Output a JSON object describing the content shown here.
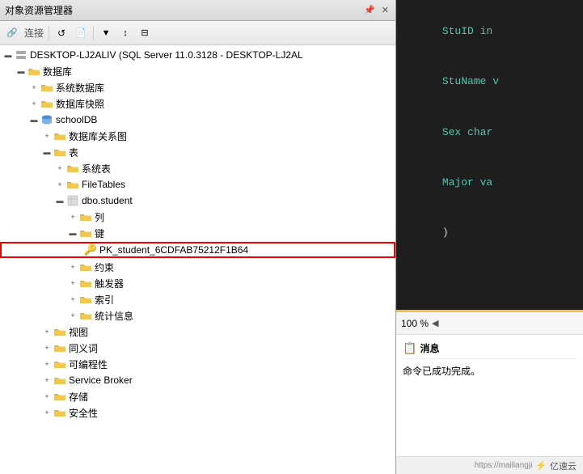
{
  "leftPanel": {
    "title": "对象资源管理器",
    "toolbar": {
      "connectLabel": "连接",
      "buttons": [
        "connect",
        "refresh",
        "filter",
        "collapse"
      ]
    },
    "tree": [
      {
        "id": "server",
        "indent": 0,
        "expand": "minus",
        "icon": "server",
        "label": "DESKTOP-LJ2ALIV (SQL Server 11.0.3128 - DESKTOP-LJ2AL",
        "selected": false
      },
      {
        "id": "databases",
        "indent": 1,
        "expand": "plus",
        "icon": "folder",
        "label": "数据库",
        "selected": false
      },
      {
        "id": "system-dbs",
        "indent": 2,
        "expand": "plus",
        "icon": "folder",
        "label": "系统数据库",
        "selected": false
      },
      {
        "id": "snapshots",
        "indent": 2,
        "expand": "plus",
        "icon": "folder",
        "label": "数据库快照",
        "selected": false
      },
      {
        "id": "schooldb",
        "indent": 2,
        "expand": "minus",
        "icon": "db",
        "label": "schoolDB",
        "selected": false
      },
      {
        "id": "diagrams",
        "indent": 3,
        "expand": "plus",
        "icon": "folder",
        "label": "数据库关系图",
        "selected": false
      },
      {
        "id": "tables",
        "indent": 3,
        "expand": "minus",
        "icon": "folder",
        "label": "表",
        "selected": false
      },
      {
        "id": "sys-tables",
        "indent": 4,
        "expand": "plus",
        "icon": "folder",
        "label": "系统表",
        "selected": false
      },
      {
        "id": "filetables",
        "indent": 4,
        "expand": "plus",
        "icon": "folder",
        "label": "FileTables",
        "selected": false
      },
      {
        "id": "student",
        "indent": 4,
        "expand": "minus",
        "icon": "table",
        "label": "dbo.student",
        "selected": false
      },
      {
        "id": "columns",
        "indent": 5,
        "expand": "plus",
        "icon": "folder",
        "label": "列",
        "selected": false
      },
      {
        "id": "keys",
        "indent": 5,
        "expand": "minus",
        "icon": "folder",
        "label": "键",
        "selected": false
      },
      {
        "id": "pk-student",
        "indent": 6,
        "expand": null,
        "icon": "key",
        "label": "PK_student_6CDFAB75212F1B64",
        "selected": false,
        "highlighted": true
      },
      {
        "id": "constraints",
        "indent": 5,
        "expand": "plus",
        "icon": "folder",
        "label": "约束",
        "selected": false
      },
      {
        "id": "triggers",
        "indent": 5,
        "expand": "plus",
        "icon": "folder",
        "label": "触发器",
        "selected": false
      },
      {
        "id": "indexes",
        "indent": 5,
        "expand": "plus",
        "icon": "folder",
        "label": "索引",
        "selected": false
      },
      {
        "id": "stats",
        "indent": 5,
        "expand": "plus",
        "icon": "folder",
        "label": "统计信息",
        "selected": false
      },
      {
        "id": "views",
        "indent": 3,
        "expand": "plus",
        "icon": "folder",
        "label": "视图",
        "selected": false
      },
      {
        "id": "synonyms",
        "indent": 3,
        "expand": "plus",
        "icon": "folder",
        "label": "同义词",
        "selected": false
      },
      {
        "id": "programmability",
        "indent": 3,
        "expand": "plus",
        "icon": "folder",
        "label": "可编程性",
        "selected": false
      },
      {
        "id": "service-broker",
        "indent": 3,
        "expand": "plus",
        "icon": "folder",
        "label": "Service Broker",
        "selected": false
      },
      {
        "id": "storage",
        "indent": 3,
        "expand": "plus",
        "icon": "folder",
        "label": "存储",
        "selected": false
      },
      {
        "id": "security",
        "indent": 3,
        "expand": "plus",
        "icon": "folder",
        "label": "安全性",
        "selected": false
      }
    ]
  },
  "rightPanel": {
    "codeLines": [
      {
        "text": "StuID in",
        "color": "cyan"
      },
      {
        "text": "StuName v",
        "color": "cyan"
      },
      {
        "text": "Sex char",
        "color": "cyan"
      },
      {
        "text": "Major va",
        "color": "cyan"
      },
      {
        "text": ")",
        "color": "white"
      }
    ],
    "zoomLevel": "100 %",
    "messages": {
      "title": "消息",
      "content": "命令已成功完成。"
    },
    "bottomBar": {
      "watermark": "亿速云",
      "url": "https://mailiangji"
    }
  }
}
